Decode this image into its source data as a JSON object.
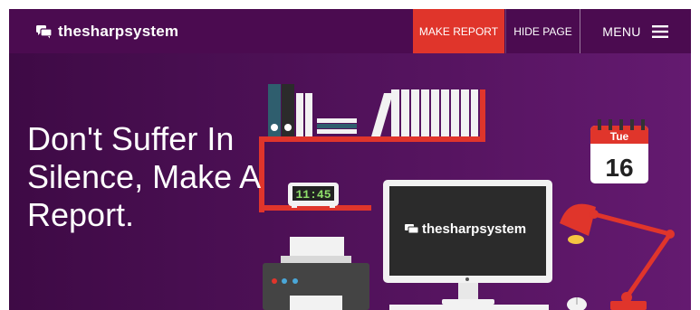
{
  "header": {
    "logo_text": "thesharpsystem",
    "make_report_label": "MAKE REPORT",
    "hide_page_label": "HIDE PAGE",
    "menu_label": "MENU"
  },
  "hero": {
    "headline": "Don't Suffer In Silence, Make A Report.",
    "clock_time": "11:45",
    "calendar_day": "Tue",
    "calendar_date": "16",
    "monitor_logo_text": "thesharpsystem"
  },
  "colors": {
    "header_bg": "#4b0b50",
    "accent_red": "#e0352b",
    "hero_purple": "#4f1158"
  }
}
